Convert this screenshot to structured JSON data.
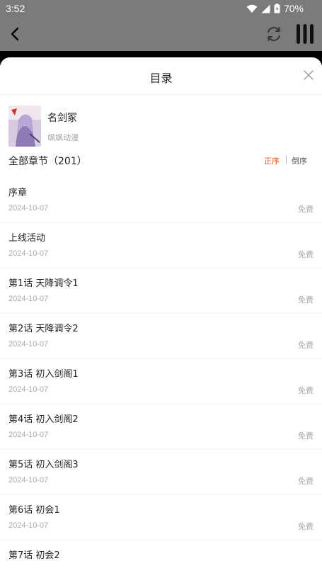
{
  "status_bar": {
    "time": "3:52",
    "battery": "70%",
    "icons": [
      "wifi-icon",
      "signal-icon",
      "battery-icon"
    ]
  },
  "app_bar": {
    "icons": [
      "back-arrow-icon",
      "refresh-icon",
      "more-icon"
    ]
  },
  "sheet": {
    "title": "目录",
    "book": {
      "title": "名剑冢",
      "author": "飒飒动漫",
      "cover_icon": "book-cover-image"
    },
    "chapter_count_label": "全部章节（201）",
    "sort": {
      "ascending": "正序",
      "descending": "倒序",
      "active": "ascending",
      "active_color": "#e4582b"
    },
    "chapters": [
      {
        "title": "序章",
        "date": "2024-10-07",
        "price": "免费"
      },
      {
        "title": "上线活动",
        "date": "2024-10-07",
        "price": "免费"
      },
      {
        "title": "第1话 天降调令1",
        "date": "2024-10-07",
        "price": "免费"
      },
      {
        "title": "第2话 天降调令2",
        "date": "2024-10-07",
        "price": "免费"
      },
      {
        "title": "第3话 初入剑阁1",
        "date": "2024-10-07",
        "price": "免费"
      },
      {
        "title": "第4话 初入剑阁2",
        "date": "2024-10-07",
        "price": "免费"
      },
      {
        "title": "第5话 初入剑阁3",
        "date": "2024-10-07",
        "price": "免费"
      },
      {
        "title": "第6话 初会1",
        "date": "2024-10-07",
        "price": "免费"
      },
      {
        "title": "第7话 初会2",
        "date": "",
        "price": ""
      }
    ]
  }
}
